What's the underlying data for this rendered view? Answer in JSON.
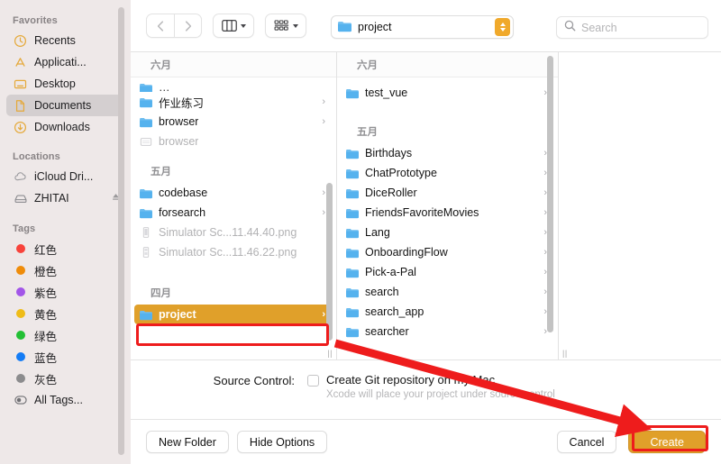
{
  "sidebar": {
    "sections": [
      {
        "header": "Favorites",
        "items": [
          {
            "label": "Recents",
            "icon": "clock-icon",
            "selected": false
          },
          {
            "label": "Applicati...",
            "icon": "applications-icon",
            "selected": false
          },
          {
            "label": "Desktop",
            "icon": "desktop-icon",
            "selected": false
          },
          {
            "label": "Documents",
            "icon": "documents-icon",
            "selected": true
          },
          {
            "label": "Downloads",
            "icon": "downloads-icon",
            "selected": false
          }
        ]
      },
      {
        "header": "Locations",
        "items": [
          {
            "label": "iCloud Dri...",
            "icon": "cloud-icon",
            "selected": false
          },
          {
            "label": "ZHITAI",
            "icon": "drive-icon",
            "selected": false,
            "eject": true
          }
        ]
      },
      {
        "header": "Tags",
        "items": [
          {
            "label": "红色",
            "icon": "tag-dot-icon",
            "color": "#f8433b",
            "selected": false
          },
          {
            "label": "橙色",
            "icon": "tag-dot-icon",
            "color": "#ef8c0a",
            "selected": false
          },
          {
            "label": "紫色",
            "icon": "tag-dot-icon",
            "color": "#a martin",
            "selected": false
          },
          {
            "label": "黄色",
            "icon": "tag-dot-icon",
            "color": "#efbc18",
            "selected": false
          },
          {
            "label": "绿色",
            "icon": "tag-dot-icon",
            "color": "#23c035",
            "selected": false
          },
          {
            "label": "蓝色",
            "icon": "tag-dot-icon",
            "color": "#147cf5",
            "selected": false
          },
          {
            "label": "灰色",
            "icon": "tag-dot-icon",
            "color": "#8c8c8e",
            "selected": false
          },
          {
            "label": "All Tags...",
            "icon": "all-tags-icon",
            "selected": false
          }
        ]
      }
    ]
  },
  "toolbar": {
    "back_icon": "chevron-left-icon",
    "forward_icon": "chevron-right-icon",
    "view_icon": "column-view-icon",
    "group_icon": "group-by-icon",
    "path_value": "project",
    "path_folder_icon": "folder-icon",
    "stepper_icon": "up-down-chevron-icon",
    "search_icon": "search-icon",
    "search_placeholder": "Search",
    "search_value": ""
  },
  "browser": {
    "column1": [
      {
        "type": "group",
        "label": "六月"
      },
      {
        "type": "folder",
        "label": "...",
        "partial": true
      },
      {
        "type": "folder",
        "label": "作业练习",
        "arrow": true
      },
      {
        "type": "folder",
        "label": "browser",
        "arrow": true
      },
      {
        "type": "file",
        "label": "browser",
        "dim": true
      },
      {
        "type": "group",
        "label": "五月"
      },
      {
        "type": "folder",
        "label": "codebase",
        "arrow": true
      },
      {
        "type": "folder",
        "label": "forsearch",
        "arrow": true
      },
      {
        "type": "file",
        "label": "Simulator Sc...11.44.40.png",
        "dim": true
      },
      {
        "type": "file",
        "label": "Simulator Sc...11.46.22.png",
        "dim": true
      },
      {
        "type": "group",
        "label": "四月"
      },
      {
        "type": "folder",
        "label": "project",
        "arrow": true,
        "selected": true
      }
    ],
    "column2": [
      {
        "type": "group",
        "label": "六月"
      },
      {
        "type": "folder",
        "label": "test_vue",
        "arrow": true
      },
      {
        "type": "group",
        "label": "五月"
      },
      {
        "type": "folder",
        "label": "Birthdays",
        "arrow": true
      },
      {
        "type": "folder",
        "label": "ChatPrototype",
        "arrow": true
      },
      {
        "type": "folder",
        "label": "DiceRoller",
        "arrow": true
      },
      {
        "type": "folder",
        "label": "FriendsFavoriteMovies",
        "arrow": true
      },
      {
        "type": "folder",
        "label": "Lang",
        "arrow": true
      },
      {
        "type": "folder",
        "label": "OnboardingFlow",
        "arrow": true
      },
      {
        "type": "folder",
        "label": "Pick-a-Pal",
        "arrow": true
      },
      {
        "type": "folder",
        "label": "search",
        "arrow": true
      },
      {
        "type": "folder",
        "label": "search_app",
        "arrow": true
      },
      {
        "type": "folder",
        "label": "searcher",
        "arrow": true
      }
    ],
    "resize_handle": "||"
  },
  "options": {
    "source_control_label": "Source Control:",
    "checkbox_checked": false,
    "checkbox_label": "Create Git repository on my Mac",
    "checkbox_hint": "Xcode will place your project under source control"
  },
  "footer": {
    "new_folder": "New Folder",
    "hide_options": "Hide Options",
    "cancel": "Cancel",
    "create": "Create"
  },
  "annotations": {
    "highlight_color": "#ee1c1c",
    "selection_color": "#e0a02a",
    "arrow_from": "project-folder-row",
    "arrow_to": "create-button"
  }
}
